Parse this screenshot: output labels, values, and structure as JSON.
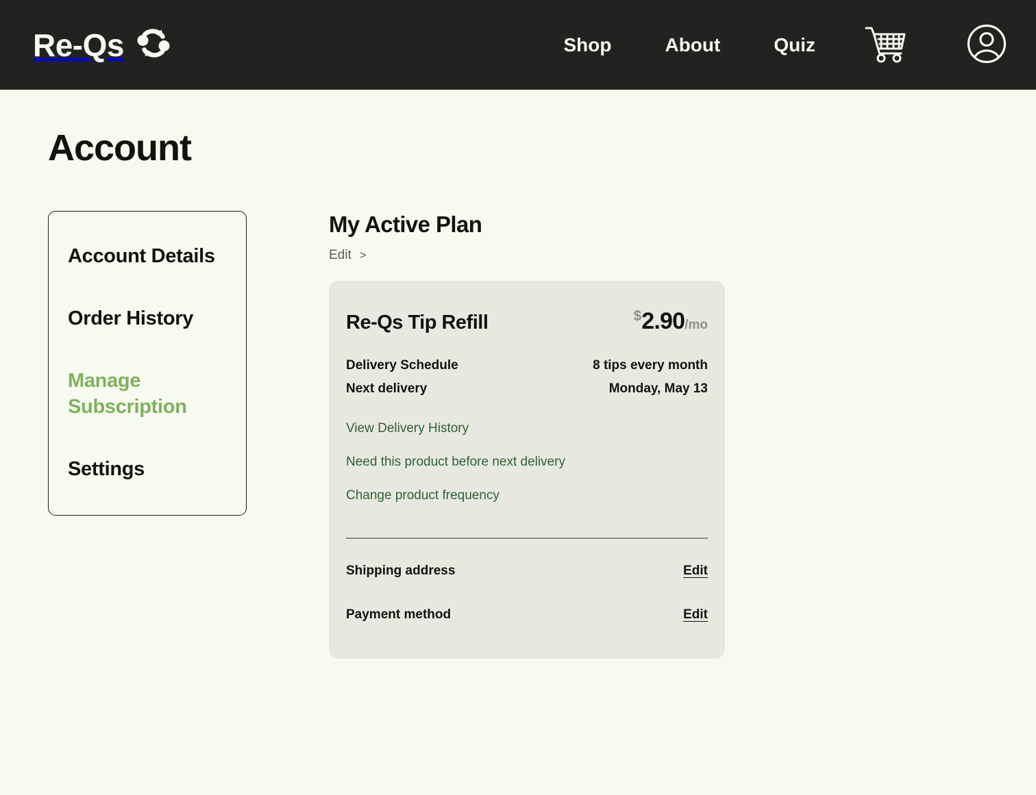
{
  "navbar": {
    "brand_text": "Re-Qs",
    "brand_icon": "recycle-refresh-icon",
    "links": [
      {
        "label": "Shop"
      },
      {
        "label": "About"
      },
      {
        "label": "Quiz"
      }
    ],
    "cart_icon": "shopping-cart-icon",
    "account_icon": "user-account-icon"
  },
  "page": {
    "title": "Account"
  },
  "sidebar": {
    "items": [
      {
        "label": "Account Details",
        "active": false
      },
      {
        "label": "Order History",
        "active": false
      },
      {
        "label": "Manage Subscription",
        "active": true
      },
      {
        "label": "Settings",
        "active": false
      }
    ]
  },
  "main": {
    "section_title": "My Active Plan",
    "edit_label": "Edit",
    "edit_chevron": ">",
    "plan": {
      "name": "Re-Qs Tip Refill",
      "price_currency": "$",
      "price_amount": "2.90",
      "price_period": "/mo",
      "details": [
        {
          "label": "Delivery Schedule",
          "value": "8 tips every month"
        },
        {
          "label": "Next delivery",
          "value": "Monday, May 13"
        }
      ],
      "links": [
        {
          "label": "View Delivery History"
        },
        {
          "label": "Need this product before next delivery"
        },
        {
          "label": "Change product frequency"
        }
      ],
      "account_rows": [
        {
          "label": "Shipping address",
          "edit_label": "Edit"
        },
        {
          "label": "Payment method",
          "edit_label": "Edit"
        }
      ]
    }
  },
  "colors": {
    "page_background": "#f7faee",
    "navbar_background": "#222220",
    "card_background": "#e7e9e0",
    "accent_green": "#7fb15e",
    "link_green": "#2f6134",
    "text_dark": "#12120f",
    "muted_gray": "#8f8f88"
  }
}
